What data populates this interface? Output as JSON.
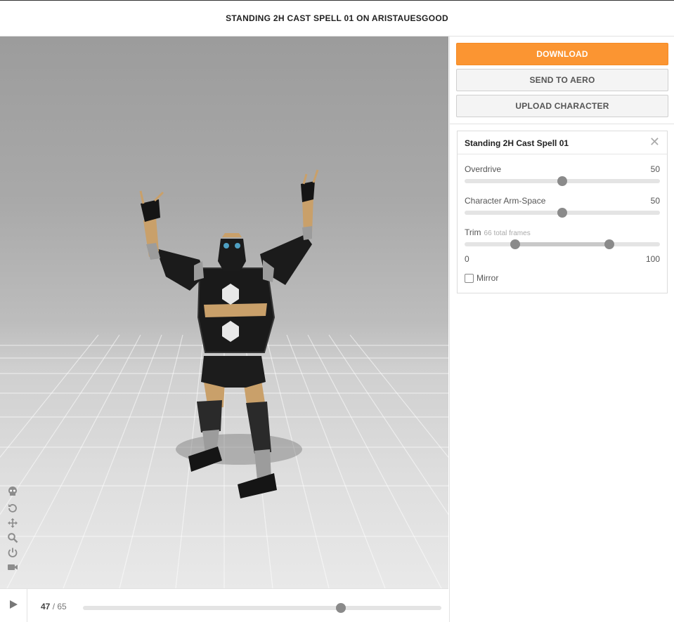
{
  "header": {
    "title": "STANDING 2H CAST SPELL 01 ON ARISTAUESGOOD"
  },
  "viewport": {
    "tools": [
      {
        "icon": "skull-icon"
      },
      {
        "icon": "rotate-icon"
      },
      {
        "icon": "move-icon"
      },
      {
        "icon": "zoom-icon"
      },
      {
        "icon": "power-icon"
      },
      {
        "icon": "camera-icon"
      }
    ]
  },
  "playback": {
    "play_icon": "play-icon",
    "current_frame": "47",
    "separator": " / ",
    "total_frames": "65",
    "progress": 0.72
  },
  "actions": {
    "download_label": "DOWNLOAD",
    "send_label": "SEND TO AERO",
    "upload_label": "UPLOAD CHARACTER"
  },
  "panel": {
    "title": "Standing 2H Cast Spell 01",
    "close_icon": "close-icon",
    "overdrive": {
      "label": "Overdrive",
      "value": "50",
      "fraction": 0.5
    },
    "arm_space": {
      "label": "Character Arm-Space",
      "value": "50",
      "fraction": 0.5
    },
    "trim": {
      "label": "Trim",
      "sub": "66 total frames",
      "min_label": "0",
      "max_label": "100",
      "start": 0.26,
      "end": 0.74
    },
    "mirror": {
      "label": "Mirror",
      "checked": false
    }
  },
  "colors": {
    "accent": "#fb9532",
    "thumb": "#8a8a8a"
  }
}
